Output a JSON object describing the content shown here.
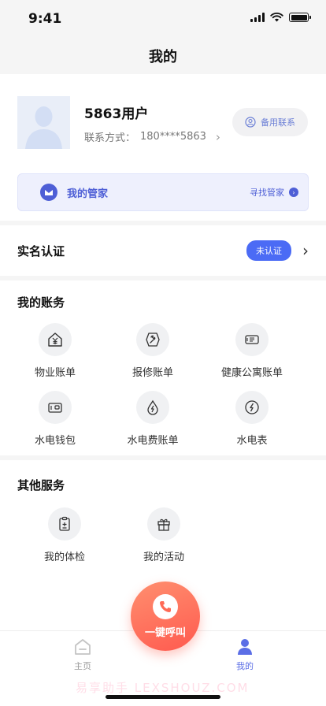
{
  "status_bar": {
    "time": "9:41"
  },
  "nav": {
    "title": "我的"
  },
  "profile": {
    "name": "5863用户",
    "contact_label": "联系方式：",
    "contact_value": "180****5863",
    "backup_button": "备用联系"
  },
  "butler": {
    "title": "我的管家",
    "link": "寻找管家"
  },
  "realname": {
    "label": "实名认证",
    "status": "未认证"
  },
  "account": {
    "title": "我的账务",
    "items": [
      {
        "label": "物业账单",
        "icon": "house-yen-icon"
      },
      {
        "label": "报修账单",
        "icon": "wrench-icon"
      },
      {
        "label": "健康公寓账单",
        "icon": "card-icon"
      },
      {
        "label": "水电钱包",
        "icon": "wallet-icon"
      },
      {
        "label": "水电费账单",
        "icon": "water-drop-icon"
      },
      {
        "label": "水电表",
        "icon": "lightning-icon"
      }
    ]
  },
  "other": {
    "title": "其他服务",
    "items": [
      {
        "label": "我的体检",
        "icon": "clipboard-icon"
      },
      {
        "label": "我的活动",
        "icon": "gift-icon"
      }
    ]
  },
  "fab": {
    "label": "一键呼叫"
  },
  "tabbar": {
    "items": [
      {
        "label": "主页",
        "active": false
      },
      {
        "label": "我的",
        "active": true
      }
    ]
  },
  "watermark": "易享助手 LEXSHOUZ.COM",
  "colors": {
    "accent": "#4b6bf5",
    "fab": "#ff6a55",
    "active_tab": "#5b6ee6"
  }
}
